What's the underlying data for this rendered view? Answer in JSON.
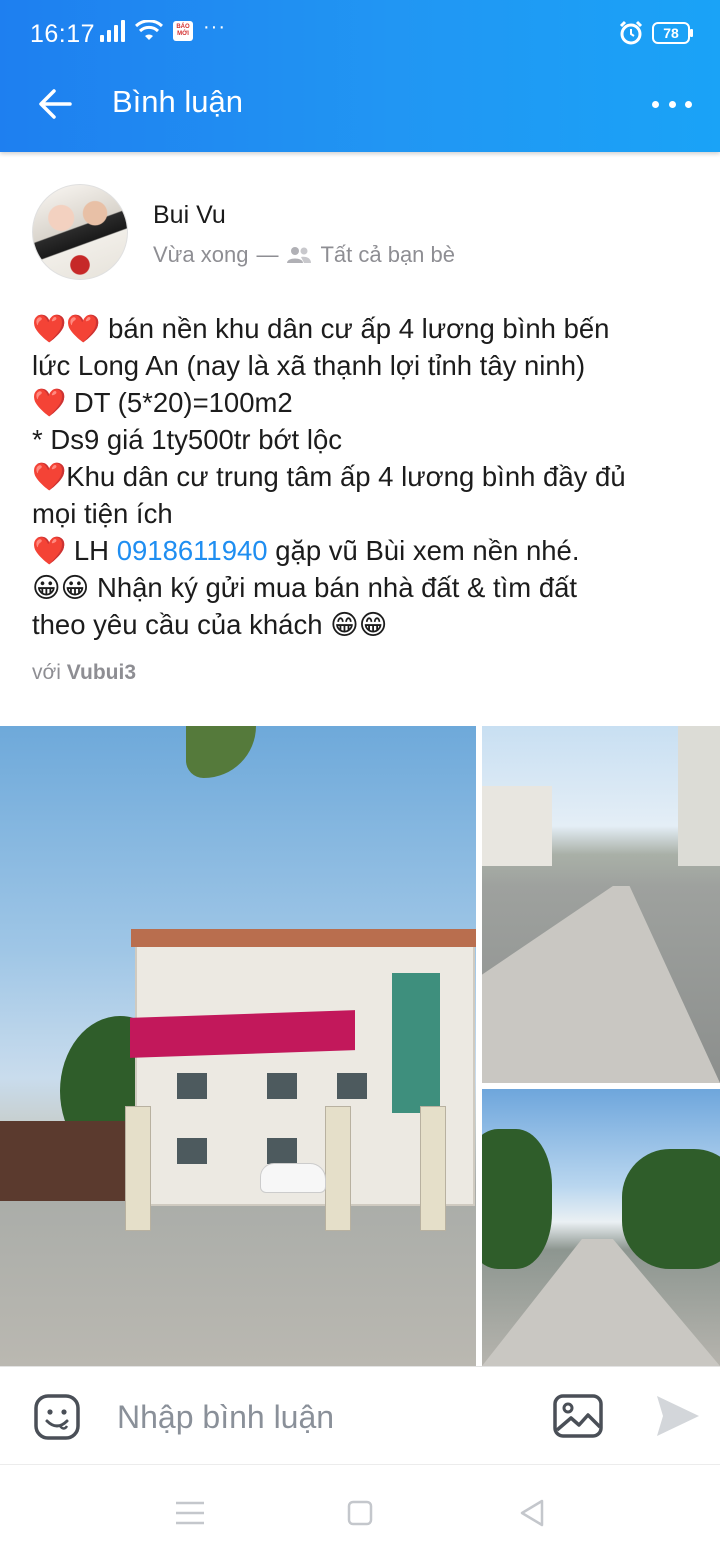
{
  "status_bar": {
    "time": "16:17",
    "notification_app_text": "BÁO MỚI",
    "overflow": "···",
    "battery": "78",
    "alarm_icon": "alarm-clock-icon"
  },
  "header": {
    "title": "Bình luận",
    "back_icon": "arrow-left-icon",
    "more_icon": "more-horizontal-icon",
    "background_color": "#2196f3"
  },
  "post": {
    "author": "Bui Vu",
    "time": "Vừa xong",
    "separator": "—",
    "privacy": "Tất cả bạn bè",
    "privacy_icon": "friends-icon",
    "body_lines": [
      "❤️❤️ bán nền khu dân cư ấp 4 lương bình bến",
      "lức Long An (nay là xã thạnh lợi tỉnh tây ninh)",
      "❤️ DT (5*20)=100m2",
      "* Ds9 giá 1ty500tr bớt lộc",
      "❤️Khu dân cư trung tâm ấp 4 lương bình đầy đủ",
      "mọi tiện ích"
    ],
    "contact_prefix": "❤️ LH ",
    "phone": "0918611940",
    "contact_suffix": " gặp vũ Bùi xem nền nhé.",
    "body_lines_after": [
      "😀😀 Nhận ký gửi mua bán nhà đất & tìm đất",
      "theo yêu cầu của khách 😁😁"
    ],
    "tagged_prefix": "với",
    "tagged_user": "Vubui3",
    "link_color": "#1f8ef1"
  },
  "comment_bar": {
    "placeholder": "Nhập bình luận",
    "sticker_icon": "sticker-smile-icon",
    "photo_icon": "image-icon",
    "send_icon": "send-icon"
  },
  "nav_bar": {
    "menu_icon": "menu-icon",
    "home_icon": "home-square-icon",
    "back_icon": "back-triangle-icon"
  }
}
